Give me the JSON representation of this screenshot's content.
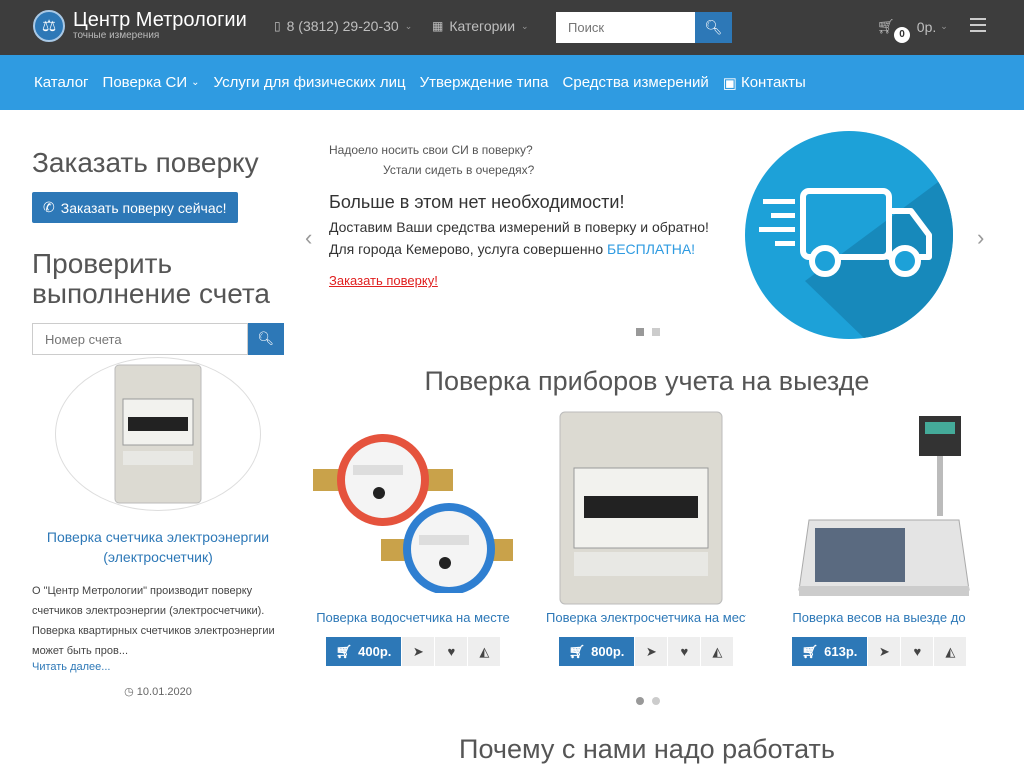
{
  "header": {
    "logo_title": "Центр Метрологии",
    "logo_subtitle": "точные измерения",
    "phone": "8 (3812) 29-20-30",
    "categories_label": "Категории",
    "search_placeholder": "Поиск",
    "cart_count": "0",
    "cart_total": "0р."
  },
  "nav": {
    "items": [
      {
        "label": "Каталог"
      },
      {
        "label": "Поверка СИ"
      },
      {
        "label": "Услуги для физических лиц"
      },
      {
        "label": "Утверждение типа"
      },
      {
        "label": "Средства измерений"
      },
      {
        "label": "Контакты"
      }
    ]
  },
  "sidebar": {
    "order_heading": "Заказать поверку",
    "order_button": "Заказать поверку сейчас!",
    "invoice_heading": "Проверить выполнение счета",
    "invoice_placeholder": "Номер счета",
    "article_title": "Поверка счетчика электроэнергии (электросчетчик)",
    "article_text": "О \"Центр Метрологии\" производит поверку счетчиков электроэнергии (электросчетчики). Поверка квартирных счетчиков электроэнергии может быть пров...",
    "read_more": "Читать далее...",
    "date": "10.01.2020"
  },
  "slider": {
    "line1": "Надоело носить свои СИ в поверку?",
    "line2": "Устали сидеть в очередях?",
    "headline": "Больше в этом нет необходимости!",
    "line3": "Доставим Ваши средства измерений в поверку и обратно!",
    "line4_prefix": "Для города Кемерово, услуга совершенно",
    "line4_highlight": "БЕСПЛАТНА!",
    "link": "Заказать поверку!",
    "active_slide": 1,
    "slide_count": 2
  },
  "products_section": {
    "title": "Поверка приборов учета на выезде",
    "items": [
      {
        "name": "Поверка водосчетчика на месте",
        "price": "400р."
      },
      {
        "name": "Поверка электросчетчика на месте",
        "price": "800р."
      },
      {
        "name": "Поверка весов на выезде до",
        "price": "613р."
      }
    ]
  },
  "why_section": {
    "title": "Почему с нами надо работать"
  },
  "colors": {
    "topbar": "#3d3d3d",
    "navbar": "#2f9be1",
    "primary": "#2d78b7"
  }
}
